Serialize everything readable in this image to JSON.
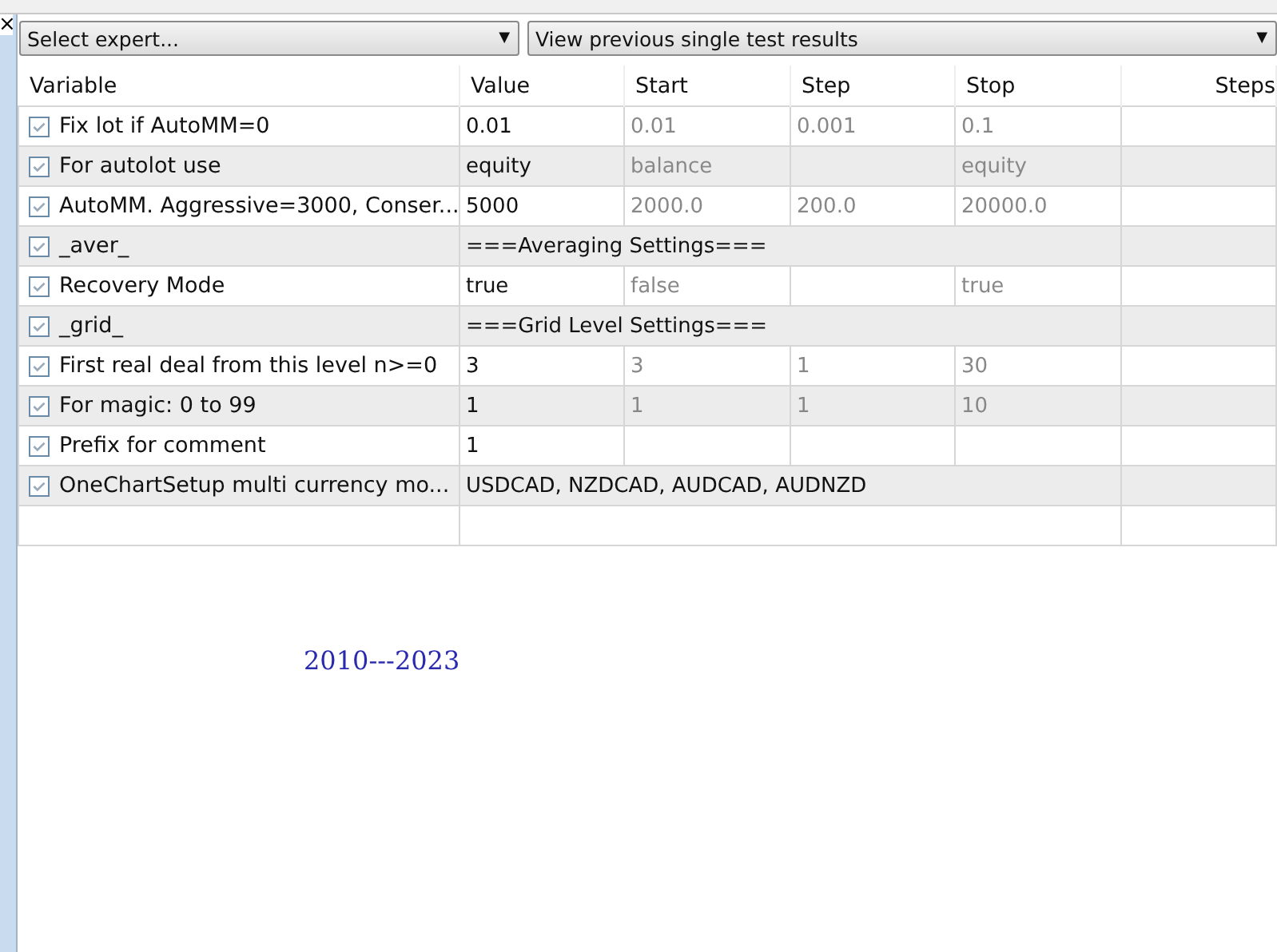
{
  "close_glyph": "×",
  "selectors": [
    {
      "label": "Select expert...",
      "caret": "▼"
    },
    {
      "label": "View previous single test results",
      "caret": "▼"
    }
  ],
  "table": {
    "columns": [
      "Variable",
      "Value",
      "Start",
      "Step",
      "Stop",
      "Steps"
    ],
    "rows": [
      {
        "kind": "param",
        "checked": true,
        "variable": "Fix lot if AutoMM=0",
        "value": "0.01",
        "start": "0.01",
        "step": "0.001",
        "stop": "0.1"
      },
      {
        "kind": "param",
        "checked": true,
        "variable": "For autolot use",
        "value": "equity",
        "start": "balance",
        "step": "",
        "stop": "equity"
      },
      {
        "kind": "param",
        "checked": true,
        "variable": "AutoMM. Aggressive=3000, Conser...",
        "value": "5000",
        "start": "2000.0",
        "step": "200.0",
        "stop": "20000.0"
      },
      {
        "kind": "section",
        "checked": true,
        "variable": "_aver_",
        "value": "===Averaging Settings==="
      },
      {
        "kind": "param",
        "checked": true,
        "variable": "Recovery Mode",
        "value": "true",
        "start": "false",
        "step": "",
        "stop": "true"
      },
      {
        "kind": "section",
        "checked": true,
        "variable": "_grid_",
        "value": "===Grid Level Settings==="
      },
      {
        "kind": "param",
        "checked": true,
        "variable": "First real deal from this level n>=0",
        "value": "3",
        "start": "3",
        "step": "1",
        "stop": "30"
      },
      {
        "kind": "param",
        "checked": true,
        "variable": "For magic: 0 to 99",
        "value": "1",
        "start": "1",
        "step": "1",
        "stop": "10"
      },
      {
        "kind": "param",
        "checked": true,
        "variable": "Prefix for comment",
        "value": "1",
        "start": "",
        "step": "",
        "stop": ""
      },
      {
        "kind": "section",
        "checked": true,
        "variable": "OneChartSetup multi currency mo...",
        "value": "USDCAD, NZDCAD, AUDCAD, AUDNZD"
      }
    ]
  },
  "note": "2010---2023"
}
